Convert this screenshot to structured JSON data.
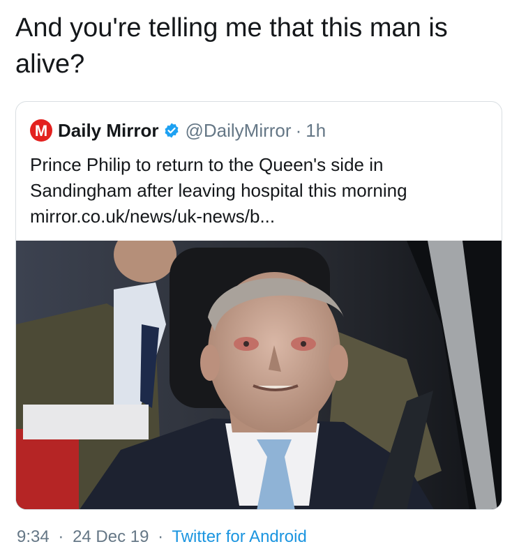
{
  "tweet": {
    "text": "And you're telling me that this man is alive?"
  },
  "quoted": {
    "logo_letter": "M",
    "author_name": "Daily Mirror",
    "handle": "@DailyMirror",
    "separator": "·",
    "time": "1h",
    "body_line1": "Prince Philip to return to the Queen's side in",
    "body_line2": "Sandingham after leaving hospital this morning",
    "link": "mirror.co.uk/news/uk-news/b..."
  },
  "meta": {
    "time": "9:34",
    "dot1": "·",
    "date": "24 Dec 19",
    "dot2": "·",
    "client": "Twitter for Android"
  },
  "colors": {
    "brand_red": "#e3211f",
    "verified_blue": "#1da1f2",
    "link_blue": "#1b95e0",
    "muted_gray": "#657786"
  },
  "icons": {
    "logo": "daily-mirror-logo-icon",
    "verified": "verified-badge-icon"
  }
}
